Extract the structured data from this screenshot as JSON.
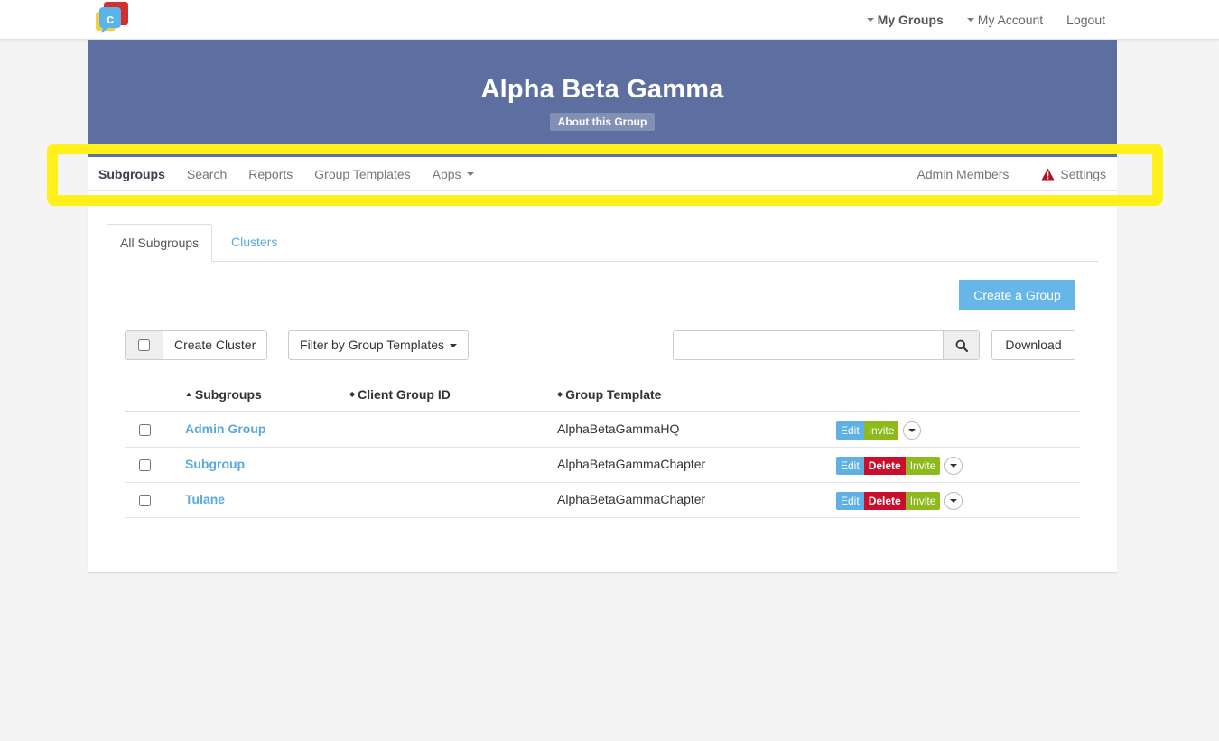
{
  "topnav": {
    "my_groups": "My Groups",
    "my_account": "My Account",
    "logout": "Logout"
  },
  "banner": {
    "title": "Alpha Beta Gamma",
    "about_label": "About this Group",
    "color": "#5d6fa1"
  },
  "subnav": {
    "items": [
      "Subgroups",
      "Search",
      "Reports",
      "Group Templates",
      "Apps"
    ],
    "active": "Subgroups",
    "admin_members": "Admin Members",
    "settings": "Settings"
  },
  "tabs": {
    "all_subgroups": "All Subgroups",
    "clusters": "Clusters"
  },
  "toolbar": {
    "create_group": "Create a Group",
    "create_cluster": "Create Cluster",
    "filter_templates": "Filter by Group Templates",
    "search_value": "",
    "download": "Download"
  },
  "table": {
    "headers": {
      "subgroups": "Subgroups",
      "client_group_id": "Client Group ID",
      "group_template": "Group Template"
    },
    "rows": [
      {
        "name": "Admin Group",
        "client_id": "",
        "template": "AlphaBetaGammaHQ",
        "actions": [
          "Edit",
          "Invite"
        ]
      },
      {
        "name": "Subgroup",
        "client_id": "",
        "template": "AlphaBetaGammaChapter",
        "actions": [
          "Edit",
          "Delete",
          "Invite"
        ]
      },
      {
        "name": "Tulane",
        "client_id": "",
        "template": "AlphaBetaGammaChapter",
        "actions": [
          "Edit",
          "Delete",
          "Invite"
        ]
      }
    ],
    "action_labels": {
      "edit": "Edit",
      "delete": "Delete",
      "invite": "Invite"
    }
  },
  "colors": {
    "accent_blue": "#66b6e8",
    "delete_red": "#c8102e",
    "invite_green": "#8dba1c",
    "highlight_yellow": "#fff01a"
  }
}
